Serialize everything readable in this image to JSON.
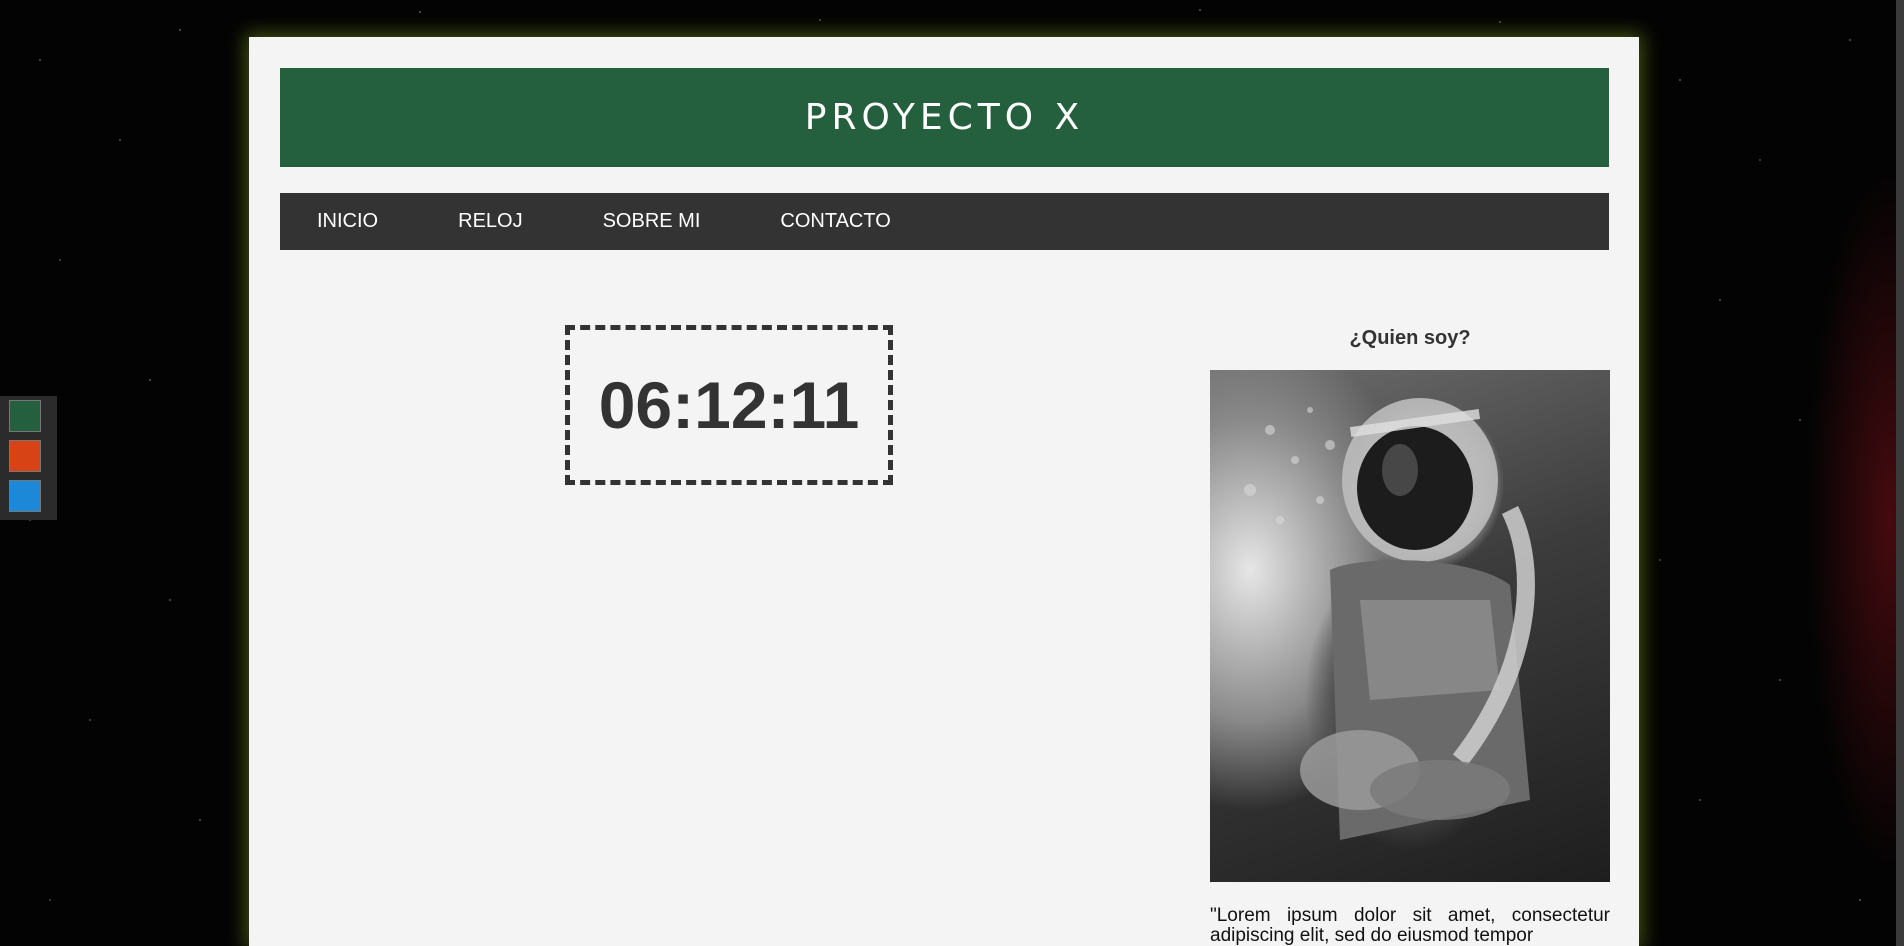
{
  "header": {
    "title": "PROYECTO X"
  },
  "nav": {
    "items": [
      {
        "label": "INICIO"
      },
      {
        "label": "RELOJ"
      },
      {
        "label": "SOBRE MI"
      },
      {
        "label": "CONTACTO"
      }
    ]
  },
  "theme_switcher": {
    "colors": [
      "#24603e",
      "#d84315",
      "#1e88d8"
    ]
  },
  "clock": {
    "time": "06:12:11"
  },
  "about": {
    "heading": "¿Quien soy?",
    "image_icon": "astronaut-photo",
    "text": "\"Lorem ipsum dolor sit amet, consectetur adipiscing elit, sed do eiusmod tempor"
  }
}
